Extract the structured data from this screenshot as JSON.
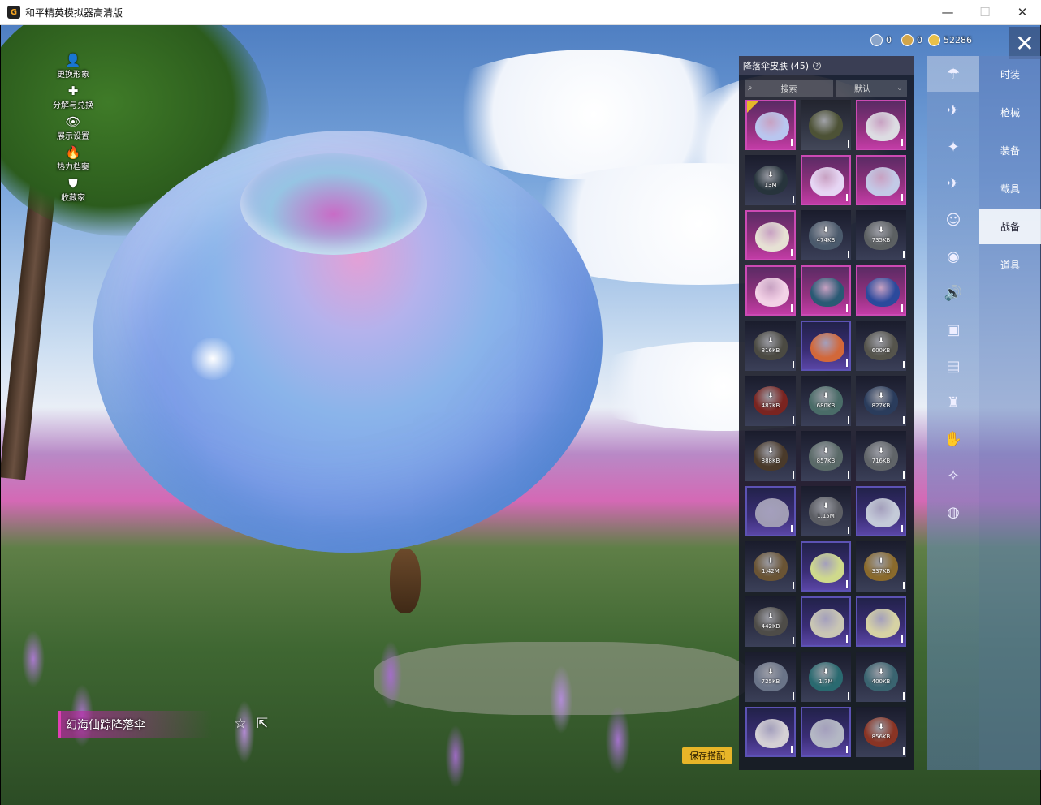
{
  "window": {
    "title": "和平精英模拟器高清版",
    "minimize": "—",
    "maximize": "☐",
    "close": "✕"
  },
  "currency": [
    {
      "icon": "globe-coin-icon",
      "value": "0",
      "color": "#8aa4c8"
    },
    {
      "icon": "a-coin-icon",
      "value": "0",
      "color": "#d2a54a"
    },
    {
      "icon": "gold-coin-icon",
      "value": "52286",
      "color": "#e8c04a"
    }
  ],
  "left_menu": [
    {
      "icon": "person-icon",
      "glyph": "👤",
      "label": "更换形象"
    },
    {
      "icon": "puzzle-icon",
      "glyph": "✚",
      "label": "分解与兑换"
    },
    {
      "icon": "eye-icon",
      "glyph": "👁",
      "label": "展示设置"
    },
    {
      "icon": "flame-icon",
      "glyph": "🔥",
      "label": "热力档案"
    },
    {
      "icon": "badge-icon",
      "glyph": "⛊",
      "label": "收藏家"
    }
  ],
  "item_name": "幻海仙踪降落伞",
  "save_label": "保存搭配",
  "panel": {
    "title": "降落伞皮肤 (45)",
    "help": "?",
    "search_placeholder": "搜索",
    "sort_label": "默认",
    "sort_chevron": "⌵"
  },
  "skins": [
    {
      "bg": "pink",
      "chute": "#b9c6ef",
      "size": "",
      "dl": false,
      "selected": true
    },
    {
      "bg": "olive",
      "chute": "#4d5236",
      "size": "",
      "dl": false
    },
    {
      "bg": "pink",
      "chute": "#dcdce2",
      "size": "",
      "dl": false
    },
    {
      "bg": "dark",
      "chute": "#27343c",
      "size": "13M",
      "dl": true
    },
    {
      "bg": "pink",
      "chute": "#e6d6f4",
      "size": "",
      "dl": false
    },
    {
      "bg": "pink",
      "chute": "#c3c9e6",
      "size": "",
      "dl": false
    },
    {
      "bg": "pink",
      "chute": "#e6e1d4",
      "size": "",
      "dl": false
    },
    {
      "bg": "dark",
      "chute": "#4b5a6c",
      "size": "474KB",
      "dl": true
    },
    {
      "bg": "dark",
      "chute": "#5c6062",
      "size": "735KB",
      "dl": true
    },
    {
      "bg": "pink",
      "chute": "#f2d2e6",
      "size": "",
      "dl": false
    },
    {
      "bg": "pink",
      "chute": "#2a5a74",
      "size": "",
      "dl": false
    },
    {
      "bg": "pink",
      "chute": "#2b4a9c",
      "size": "",
      "dl": false
    },
    {
      "bg": "dark",
      "chute": "#4b4a42",
      "size": "816KB",
      "dl": true
    },
    {
      "bg": "purple",
      "chute": "#d2683a",
      "size": "",
      "dl": false
    },
    {
      "bg": "dark",
      "chute": "#55544c",
      "size": "600KB",
      "dl": true
    },
    {
      "bg": "dark",
      "chute": "#7a2420",
      "size": "487KB",
      "dl": true
    },
    {
      "bg": "dark",
      "chute": "#4a6c68",
      "size": "680KB",
      "dl": true
    },
    {
      "bg": "dark",
      "chute": "#2a3c5c",
      "size": "827KB",
      "dl": true
    },
    {
      "bg": "dark",
      "chute": "#4a3a2a",
      "size": "888KB",
      "dl": true
    },
    {
      "bg": "dark",
      "chute": "#5a6a68",
      "size": "857KB",
      "dl": true
    },
    {
      "bg": "dark",
      "chute": "#606468",
      "size": "716KB",
      "dl": true
    },
    {
      "bg": "purple",
      "chute": "#a09cb4",
      "size": "",
      "dl": false
    },
    {
      "bg": "dark",
      "chute": "#5c5e64",
      "size": "1.15M",
      "dl": true
    },
    {
      "bg": "purple",
      "chute": "#c4cad8",
      "size": "",
      "dl": false
    },
    {
      "bg": "dark",
      "chute": "#6a5434",
      "size": "1.42M",
      "dl": true
    },
    {
      "bg": "purple",
      "chute": "#cfd98c",
      "size": "",
      "dl": false
    },
    {
      "bg": "dark",
      "chute": "#8a6a2c",
      "size": "337KB",
      "dl": true
    },
    {
      "bg": "dark",
      "chute": "#4e4c48",
      "size": "442KB",
      "dl": true
    },
    {
      "bg": "purple",
      "chute": "#c9c6b4",
      "size": "",
      "dl": false
    },
    {
      "bg": "purple",
      "chute": "#d6d2a4",
      "size": "",
      "dl": false
    },
    {
      "bg": "dark",
      "chute": "#6a7488",
      "size": "725KB",
      "dl": true
    },
    {
      "bg": "dark",
      "chute": "#2a6a70",
      "size": "1.7M",
      "dl": true
    },
    {
      "bg": "dark",
      "chute": "#3a6470",
      "size": "400KB",
      "dl": true
    },
    {
      "bg": "purple",
      "chute": "#d4d0d4",
      "size": "",
      "dl": false
    },
    {
      "bg": "purple",
      "chute": "#b4b8c4",
      "size": "",
      "dl": false
    },
    {
      "bg": "dark",
      "chute": "#8a3424",
      "size": "856KB",
      "dl": true
    }
  ],
  "tabs": [
    {
      "icon": "parachute-icon",
      "glyph": "☂",
      "active": true
    },
    {
      "icon": "glider-icon",
      "glyph": "✈"
    },
    {
      "icon": "drone-icon",
      "glyph": "✦"
    },
    {
      "icon": "plane-icon",
      "glyph": "✈"
    },
    {
      "icon": "emote-icon",
      "glyph": "☺"
    },
    {
      "icon": "robot-icon",
      "glyph": "◉"
    },
    {
      "icon": "sound-icon",
      "glyph": "🔊"
    },
    {
      "icon": "pet-icon",
      "glyph": "▣"
    },
    {
      "icon": "picture-icon",
      "glyph": "▤"
    },
    {
      "icon": "spray-icon",
      "glyph": "♜"
    },
    {
      "icon": "hand-icon",
      "glyph": "✋"
    },
    {
      "icon": "wand-icon",
      "glyph": "✧"
    },
    {
      "icon": "ufo-icon",
      "glyph": "◍"
    }
  ],
  "categories": [
    {
      "label": "时装"
    },
    {
      "label": "枪械"
    },
    {
      "label": "装备"
    },
    {
      "label": "载具"
    },
    {
      "label": "战备",
      "active": true
    },
    {
      "label": "道具"
    }
  ],
  "colors": {
    "accent": "#e03fb4",
    "save": "#e7b528",
    "pink_border": "#cc4ab4",
    "purple_border": "#5c52b4"
  }
}
